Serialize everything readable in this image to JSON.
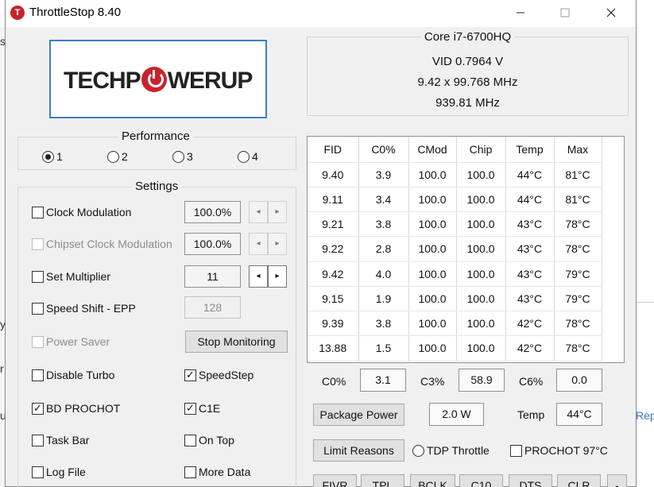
{
  "window": {
    "title": "ThrottleStop 8.40",
    "controls": [
      "minimize",
      "maximize",
      "close"
    ]
  },
  "background_window": {
    "fragments": [
      "s",
      "y",
      "r",
      "u"
    ],
    "right_link": "Rep"
  },
  "logo": {
    "text_before": "TECHP",
    "text_after": "WERUP"
  },
  "cpu_info": {
    "model": "Core i7-6700HQ",
    "vid": "VID  0.7964 V",
    "multiplier": "9.42 x 99.768 MHz",
    "frequency": "939.81 MHz"
  },
  "performance": {
    "title": "Performance",
    "options": [
      {
        "label": "1",
        "selected": true
      },
      {
        "label": "2",
        "selected": false
      },
      {
        "label": "3",
        "selected": false
      },
      {
        "label": "4",
        "selected": false
      }
    ]
  },
  "settings": {
    "title": "Settings",
    "clock_modulation": {
      "label": "Clock Modulation",
      "value": "100.0%",
      "checked": false,
      "enabled": true
    },
    "chipset_clock_modulation": {
      "label": "Chipset Clock Modulation",
      "value": "100.0%",
      "checked": false,
      "enabled": false
    },
    "set_multiplier": {
      "label": "Set Multiplier",
      "value": "11",
      "checked": false,
      "enabled": true
    },
    "speed_shift": {
      "label": "Speed Shift - EPP",
      "value": "128",
      "checked": false,
      "enabled": true
    },
    "power_saver": {
      "label": "Power Saver",
      "checked": false,
      "enabled": false
    },
    "stop_monitoring_button": "Stop Monitoring",
    "disable_turbo": {
      "label": "Disable Turbo",
      "checked": false
    },
    "speedstep": {
      "label": "SpeedStep",
      "checked": true
    },
    "bd_prochot": {
      "label": "BD PROCHOT",
      "checked": true
    },
    "c1e": {
      "label": "C1E",
      "checked": true
    },
    "task_bar": {
      "label": "Task Bar",
      "checked": false
    },
    "on_top": {
      "label": "On Top",
      "checked": false
    },
    "log_file": {
      "label": "Log File",
      "checked": false
    },
    "more_data": {
      "label": "More Data",
      "checked": false
    }
  },
  "core_table": {
    "columns": [
      "FID",
      "C0%",
      "CMod",
      "Chip",
      "Temp",
      "Max"
    ],
    "rows": [
      [
        "9.40",
        "3.9",
        "100.0",
        "100.0",
        "44°C",
        "81°C"
      ],
      [
        "9.11",
        "3.4",
        "100.0",
        "100.0",
        "44°C",
        "81°C"
      ],
      [
        "9.21",
        "3.8",
        "100.0",
        "100.0",
        "43°C",
        "78°C"
      ],
      [
        "9.22",
        "2.8",
        "100.0",
        "100.0",
        "43°C",
        "78°C"
      ],
      [
        "9.42",
        "4.0",
        "100.0",
        "100.0",
        "43°C",
        "79°C"
      ],
      [
        "9.15",
        "1.9",
        "100.0",
        "100.0",
        "43°C",
        "79°C"
      ],
      [
        "9.39",
        "3.8",
        "100.0",
        "100.0",
        "42°C",
        "78°C"
      ],
      [
        "13.88",
        "1.5",
        "100.0",
        "100.0",
        "42°C",
        "78°C"
      ]
    ]
  },
  "cstates": {
    "c0_label": "C0%",
    "c0_value": "3.1",
    "c3_label": "C3%",
    "c3_value": "58.9",
    "c6_label": "C6%",
    "c6_value": "0.0"
  },
  "power": {
    "package_power_button": "Package Power",
    "package_power_value": "2.0 W",
    "temp_label": "Temp",
    "temp_value": "44°C"
  },
  "limits": {
    "limit_reasons_button": "Limit Reasons",
    "tdp_throttle_label": "TDP Throttle",
    "prochot_label": "PROCHOT 97°C"
  },
  "bottom_buttons": [
    "FIVR",
    "TPL",
    "BCLK",
    "C10",
    "DTS",
    "CLR",
    "-"
  ]
}
